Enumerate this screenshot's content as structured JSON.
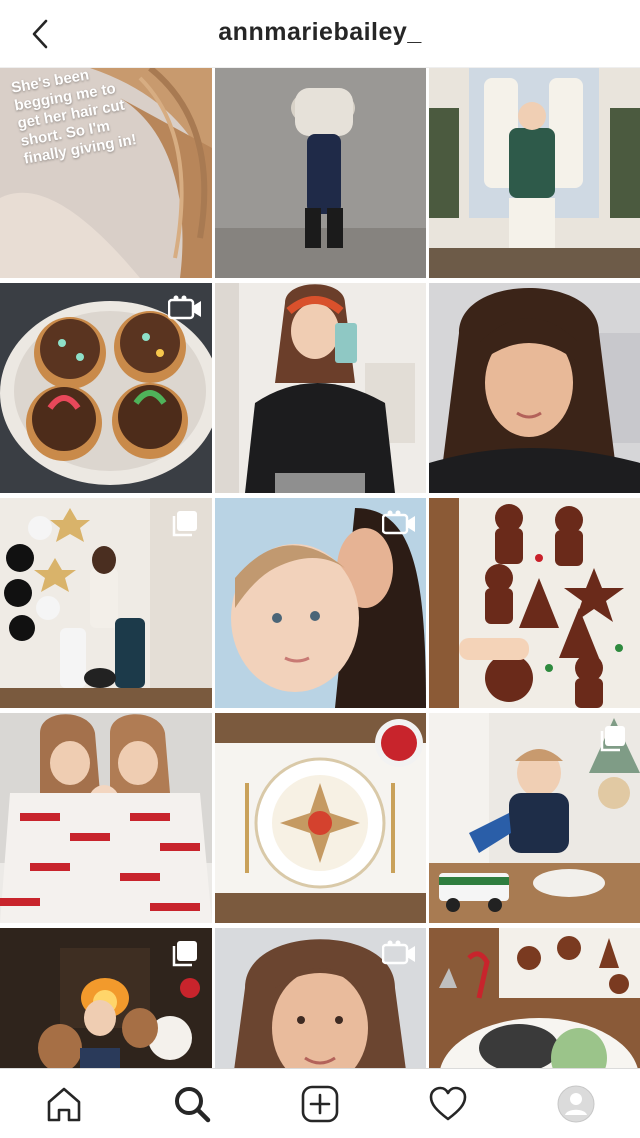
{
  "header": {
    "username": "annmariebailey_",
    "back_icon": "chevron-left-icon"
  },
  "grid": {
    "tiles": [
      {
        "id": 1,
        "subject": "hair",
        "badge": "none",
        "caption_lines": [
          "She's been",
          "begging me to",
          "get her hair cut",
          "short. So I'm",
          "finally giving in!"
        ]
      },
      {
        "id": 2,
        "subject": "toddler-walking",
        "badge": "none"
      },
      {
        "id": 3,
        "subject": "kids-at-door",
        "badge": "none"
      },
      {
        "id": 4,
        "subject": "donuts",
        "badge": "reel-icon"
      },
      {
        "id": 5,
        "subject": "mirror-selfie",
        "badge": "none"
      },
      {
        "id": 6,
        "subject": "selfie",
        "badge": "none"
      },
      {
        "id": 7,
        "subject": "new-year-family",
        "badge": "carousel-icon"
      },
      {
        "id": 8,
        "subject": "mom-kissing-baby",
        "badge": "reel-icon"
      },
      {
        "id": 9,
        "subject": "gingerbread-cookies",
        "badge": "none"
      },
      {
        "id": 10,
        "subject": "kids-in-pajamas",
        "badge": "none"
      },
      {
        "id": 11,
        "subject": "holiday-plate",
        "badge": "none"
      },
      {
        "id": 12,
        "subject": "baby-with-truck",
        "badge": "carousel-icon"
      },
      {
        "id": 13,
        "subject": "fireplace-kids",
        "badge": "carousel-icon"
      },
      {
        "id": 14,
        "subject": "selfie-closeup",
        "badge": "reel-icon"
      },
      {
        "id": 15,
        "subject": "cookie-platter",
        "badge": "none"
      }
    ]
  },
  "tabbar": {
    "items": [
      {
        "name": "home-icon",
        "active": false
      },
      {
        "name": "search-icon",
        "active": true
      },
      {
        "name": "new-post-icon",
        "active": false
      },
      {
        "name": "activity-heart-icon",
        "active": false
      },
      {
        "name": "profile-avatar-icon",
        "active": false
      }
    ]
  },
  "colors": {
    "text": "#262626",
    "border": "#dbdbdb",
    "background": "#ffffff"
  }
}
